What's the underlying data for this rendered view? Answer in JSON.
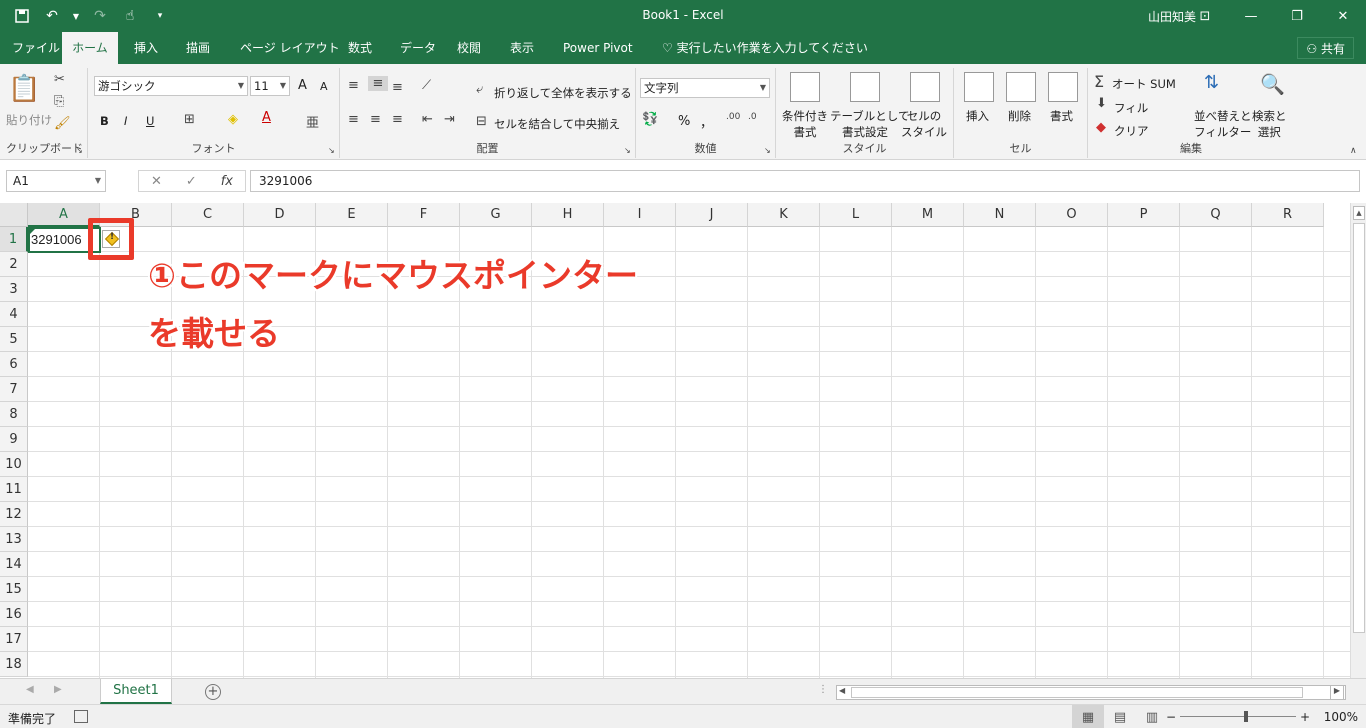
{
  "window": {
    "title": "Book1 - Excel",
    "user": "山田知美"
  },
  "tabs": [
    "ファイル",
    "ホーム",
    "挿入",
    "描画",
    "ページ レイアウト",
    "数式",
    "データ",
    "校閲",
    "表示",
    "Power Pivot"
  ],
  "active_tab": "ホーム",
  "tell_me": "実行したい作業を入力してください",
  "share_label": "共有",
  "ribbon": {
    "clipboard": {
      "paste": "貼り付け",
      "label": "クリップボード"
    },
    "font": {
      "name": "游ゴシック",
      "size": "11",
      "bold": "B",
      "italic": "I",
      "underline": "U",
      "grow": "A",
      "shrink": "A",
      "label": "フォント"
    },
    "alignment": {
      "wrap": "折り返して全体を表示する",
      "merge": "セルを結合して中央揃え",
      "label": "配置"
    },
    "number": {
      "format": "文字列",
      "percent": "%",
      "comma": "，",
      "label": "数値"
    },
    "styles": {
      "conditional": [
        "条件付き",
        "書式"
      ],
      "table": [
        "テーブルとして",
        "書式設定"
      ],
      "cell": [
        "セルの",
        "スタイル"
      ],
      "label": "スタイル"
    },
    "cells": {
      "insert": "挿入",
      "delete": "削除",
      "format": "書式",
      "label": "セル"
    },
    "editing": {
      "autosum": "オート SUM",
      "fill": "フィル",
      "clear": "クリア",
      "sort": [
        "並べ替えと",
        "フィルター"
      ],
      "find": [
        "検索と",
        "選択"
      ],
      "label": "編集"
    }
  },
  "formula_bar": {
    "name_box": "A1",
    "value": "3291006"
  },
  "grid": {
    "columns": [
      "A",
      "B",
      "C",
      "D",
      "E",
      "F",
      "G",
      "H",
      "I",
      "J",
      "K",
      "L",
      "M",
      "N",
      "O",
      "P",
      "Q",
      "R"
    ],
    "rows": [
      "1",
      "2",
      "3",
      "4",
      "5",
      "6",
      "7",
      "8",
      "9",
      "10",
      "11",
      "12",
      "13",
      "14",
      "15",
      "16",
      "17",
      "18"
    ],
    "active_cell_value": "3291006"
  },
  "annotation": {
    "line1": "①このマークにマウスポインター",
    "line2": "を載せる",
    "color": "#ea3a2a"
  },
  "sheets": [
    "Sheet1"
  ],
  "status": {
    "text": "準備完了",
    "zoom": "100%"
  },
  "colors": {
    "brand": "#217346"
  }
}
